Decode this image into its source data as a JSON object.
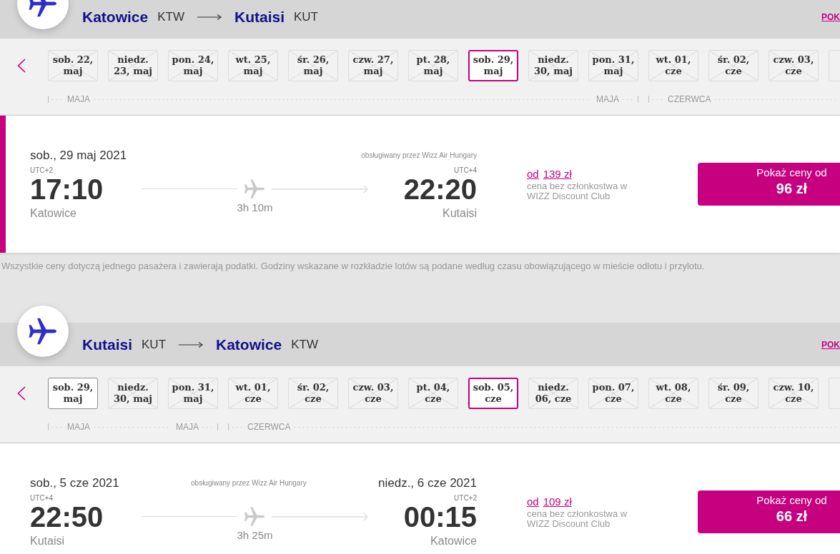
{
  "journeys": [
    {
      "route": {
        "from": {
          "city": "Katowice",
          "code": "KTW"
        },
        "to": {
          "city": "Kutaisi",
          "code": "KUT"
        }
      },
      "header_link": "POK",
      "months": [
        {
          "labels": [
            "MAJA",
            "MAJA"
          ],
          "days": [
            {
              "label": "sob. 22, maj",
              "available": false,
              "selected": false
            },
            {
              "label": "niedz. 23, maj",
              "available": false,
              "selected": false
            },
            {
              "label": "pon. 24, maj",
              "available": false,
              "selected": false
            },
            {
              "label": "wt. 25, maj",
              "available": false,
              "selected": false
            },
            {
              "label": "śr. 26, maj",
              "available": false,
              "selected": false
            },
            {
              "label": "czw. 27, maj",
              "available": false,
              "selected": false
            },
            {
              "label": "pt. 28, maj",
              "available": false,
              "selected": false
            },
            {
              "label": "sob. 29, maj",
              "available": true,
              "selected": true
            },
            {
              "label": "niedz. 30, maj",
              "available": false,
              "selected": false
            },
            {
              "label": "pon. 31, maj",
              "available": false,
              "selected": false
            }
          ]
        },
        {
          "labels": [
            "CZERWCA"
          ],
          "days": [
            {
              "label": "wt. 01, cze",
              "available": false,
              "selected": false
            },
            {
              "label": "śr. 02, cze",
              "available": false,
              "selected": false
            },
            {
              "label": "czw. 03, cze",
              "available": false,
              "selected": false
            }
          ]
        }
      ],
      "flight": {
        "selected": true,
        "departure": {
          "date": "sob., 29 maj 2021",
          "timezone": "UTC+2",
          "time": "17:10",
          "city": "Katowice"
        },
        "operator": "obsługiwany przez Wizz Air Hungary",
        "duration": "3h 10m",
        "arrival": {
          "timezone": "UTC+4",
          "time": "22:20",
          "city": "Kutaisi"
        },
        "price_prefix": "od",
        "regular_price": "139 zł",
        "price_note": "cena bez członkostwa w WIZZ Discount Club",
        "button": {
          "label": "Pokaż ceny od",
          "price": "96 zł"
        }
      },
      "footnote": "Wszystkie ceny dotyczą jednego pasażera i zawierają podatki. Godziny wskazane w rozkładzie lotów są podane według czasu obowiązującego w mieście odlotu i przylotu."
    },
    {
      "route": {
        "from": {
          "city": "Kutaisi",
          "code": "KUT"
        },
        "to": {
          "city": "Katowice",
          "code": "KTW"
        }
      },
      "header_link": "POK",
      "months": [
        {
          "labels": [
            "MAJA",
            "MAJA"
          ],
          "days": [
            {
              "label": "sob. 29, maj",
              "available": true,
              "selected": false
            },
            {
              "label": "niedz. 30, maj",
              "available": false,
              "selected": false
            },
            {
              "label": "pon. 31, maj",
              "available": false,
              "selected": false
            }
          ]
        },
        {
          "labels": [
            "CZERWCA"
          ],
          "days": [
            {
              "label": "wt. 01, cze",
              "available": false,
              "selected": false
            },
            {
              "label": "śr. 02, cze",
              "available": false,
              "selected": false
            },
            {
              "label": "czw. 03, cze",
              "available": false,
              "selected": false
            },
            {
              "label": "pt. 04, cze",
              "available": false,
              "selected": false
            },
            {
              "label": "sob. 05, cze",
              "available": true,
              "selected": true
            },
            {
              "label": "niedz. 06, cze",
              "available": false,
              "selected": false
            },
            {
              "label": "pon. 07, cze",
              "available": false,
              "selected": false
            },
            {
              "label": "wt. 08, cze",
              "available": false,
              "selected": false
            },
            {
              "label": "śr. 09, cze",
              "available": false,
              "selected": false
            },
            {
              "label": "czw. 10, cze",
              "available": false,
              "selected": false
            }
          ]
        }
      ],
      "flight": {
        "selected": false,
        "departure": {
          "date": "sob., 5 cze 2021",
          "timezone": "UTC+4",
          "time": "22:50",
          "city": "Kutaisi"
        },
        "operator": "obsługiwany przez Wizz Air Hungary",
        "duration": "3h 25m",
        "arrival": {
          "date": "niedz., 6 cze 2021",
          "timezone": "UTC+2",
          "time": "00:15",
          "city": "Katowice"
        },
        "price_prefix": "od",
        "regular_price": "109 zł",
        "price_note": "cena bez członkostwa w WIZZ Discount Club",
        "button": {
          "label": "Pokaż ceny od",
          "price": "66 zł"
        }
      }
    }
  ]
}
